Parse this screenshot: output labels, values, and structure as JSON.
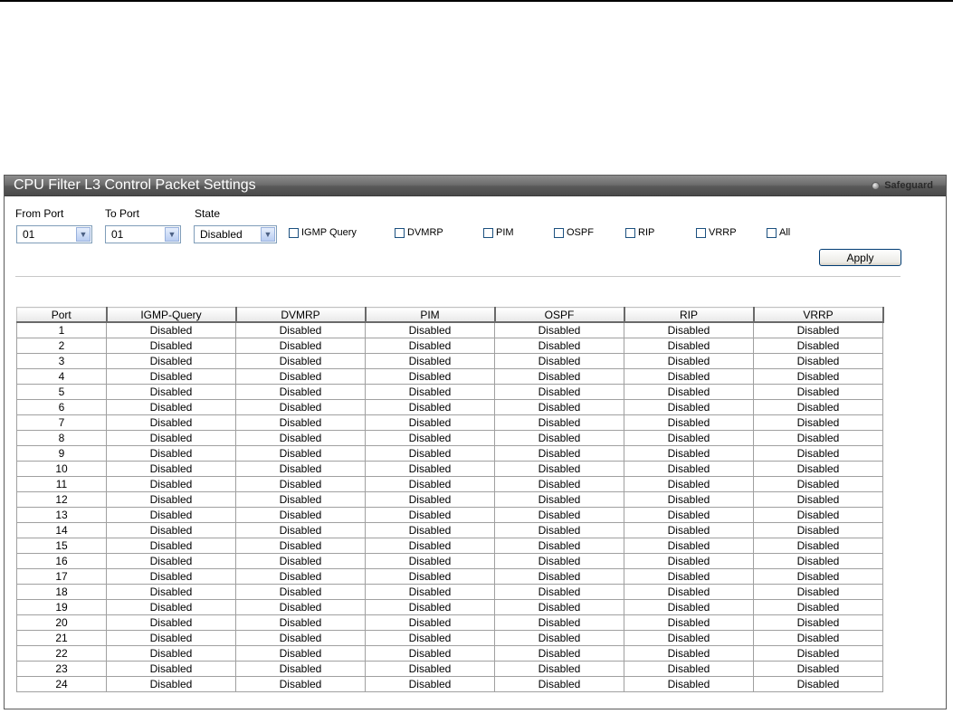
{
  "panel": {
    "title": "CPU Filter L3 Control Packet Settings",
    "safeguard_label": "Safeguard"
  },
  "form": {
    "from_port": {
      "label": "From Port",
      "value": "01"
    },
    "to_port": {
      "label": "To Port",
      "value": "01"
    },
    "state": {
      "label": "State",
      "value": "Disabled"
    },
    "checkboxes": [
      {
        "label": "IGMP Query",
        "checked": false
      },
      {
        "label": "DVMRP",
        "checked": false
      },
      {
        "label": "PIM",
        "checked": false
      },
      {
        "label": "OSPF",
        "checked": false
      },
      {
        "label": "RIP",
        "checked": false
      },
      {
        "label": "VRRP",
        "checked": false
      },
      {
        "label": "All",
        "checked": false
      }
    ],
    "apply_label": "Apply"
  },
  "table": {
    "headers": [
      "Port",
      "IGMP-Query",
      "DVMRP",
      "PIM",
      "OSPF",
      "RIP",
      "VRRP"
    ],
    "rows": [
      [
        "1",
        "Disabled",
        "Disabled",
        "Disabled",
        "Disabled",
        "Disabled",
        "Disabled"
      ],
      [
        "2",
        "Disabled",
        "Disabled",
        "Disabled",
        "Disabled",
        "Disabled",
        "Disabled"
      ],
      [
        "3",
        "Disabled",
        "Disabled",
        "Disabled",
        "Disabled",
        "Disabled",
        "Disabled"
      ],
      [
        "4",
        "Disabled",
        "Disabled",
        "Disabled",
        "Disabled",
        "Disabled",
        "Disabled"
      ],
      [
        "5",
        "Disabled",
        "Disabled",
        "Disabled",
        "Disabled",
        "Disabled",
        "Disabled"
      ],
      [
        "6",
        "Disabled",
        "Disabled",
        "Disabled",
        "Disabled",
        "Disabled",
        "Disabled"
      ],
      [
        "7",
        "Disabled",
        "Disabled",
        "Disabled",
        "Disabled",
        "Disabled",
        "Disabled"
      ],
      [
        "8",
        "Disabled",
        "Disabled",
        "Disabled",
        "Disabled",
        "Disabled",
        "Disabled"
      ],
      [
        "9",
        "Disabled",
        "Disabled",
        "Disabled",
        "Disabled",
        "Disabled",
        "Disabled"
      ],
      [
        "10",
        "Disabled",
        "Disabled",
        "Disabled",
        "Disabled",
        "Disabled",
        "Disabled"
      ],
      [
        "11",
        "Disabled",
        "Disabled",
        "Disabled",
        "Disabled",
        "Disabled",
        "Disabled"
      ],
      [
        "12",
        "Disabled",
        "Disabled",
        "Disabled",
        "Disabled",
        "Disabled",
        "Disabled"
      ],
      [
        "13",
        "Disabled",
        "Disabled",
        "Disabled",
        "Disabled",
        "Disabled",
        "Disabled"
      ],
      [
        "14",
        "Disabled",
        "Disabled",
        "Disabled",
        "Disabled",
        "Disabled",
        "Disabled"
      ],
      [
        "15",
        "Disabled",
        "Disabled",
        "Disabled",
        "Disabled",
        "Disabled",
        "Disabled"
      ],
      [
        "16",
        "Disabled",
        "Disabled",
        "Disabled",
        "Disabled",
        "Disabled",
        "Disabled"
      ],
      [
        "17",
        "Disabled",
        "Disabled",
        "Disabled",
        "Disabled",
        "Disabled",
        "Disabled"
      ],
      [
        "18",
        "Disabled",
        "Disabled",
        "Disabled",
        "Disabled",
        "Disabled",
        "Disabled"
      ],
      [
        "19",
        "Disabled",
        "Disabled",
        "Disabled",
        "Disabled",
        "Disabled",
        "Disabled"
      ],
      [
        "20",
        "Disabled",
        "Disabled",
        "Disabled",
        "Disabled",
        "Disabled",
        "Disabled"
      ],
      [
        "21",
        "Disabled",
        "Disabled",
        "Disabled",
        "Disabled",
        "Disabled",
        "Disabled"
      ],
      [
        "22",
        "Disabled",
        "Disabled",
        "Disabled",
        "Disabled",
        "Disabled",
        "Disabled"
      ],
      [
        "23",
        "Disabled",
        "Disabled",
        "Disabled",
        "Disabled",
        "Disabled",
        "Disabled"
      ],
      [
        "24",
        "Disabled",
        "Disabled",
        "Disabled",
        "Disabled",
        "Disabled",
        "Disabled"
      ]
    ]
  },
  "colors": {
    "header_dark": "#4a4a4a",
    "header_light": "#8c8c8c",
    "title_text": "#ffffff",
    "select_border": "#7f9db9",
    "checkbox_border": "#1c5180",
    "button_border": "#003c74"
  },
  "icons": {
    "select_arrow": "chevron-down-icon",
    "safeguard": "safeguard-indicator-icon"
  }
}
